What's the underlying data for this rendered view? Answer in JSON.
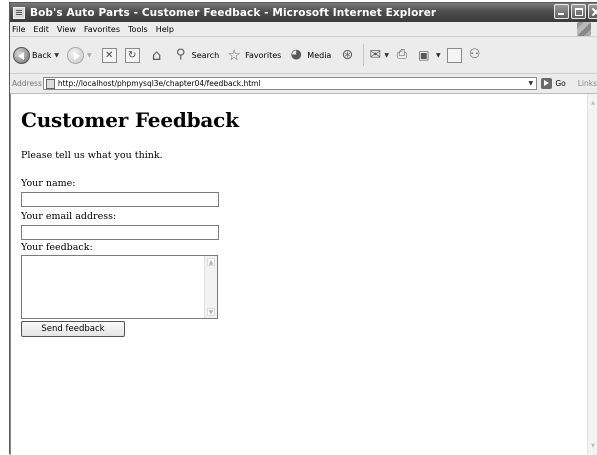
{
  "window": {
    "title": "Bob's Auto Parts - Customer Feedback - Microsoft Internet Explorer"
  },
  "menu": {
    "items": [
      "File",
      "Edit",
      "View",
      "Favorites",
      "Tools",
      "Help"
    ]
  },
  "toolbar": {
    "back_label": "Back",
    "search_label": "Search",
    "favorites_label": "Favorites",
    "media_label": "Media"
  },
  "address": {
    "label": "Address",
    "url": "http://localhost/phpmysql3e/chapter04/feedback.html",
    "go_label": "Go",
    "links_label": "Links"
  },
  "page": {
    "heading": "Customer Feedback",
    "intro": "Please tell us what you think.",
    "name_label": "Your name:",
    "name_value": "",
    "email_label": "Your email address:",
    "email_value": "",
    "feedback_label": "Your feedback:",
    "feedback_value": "",
    "submit_label": "Send feedback"
  }
}
